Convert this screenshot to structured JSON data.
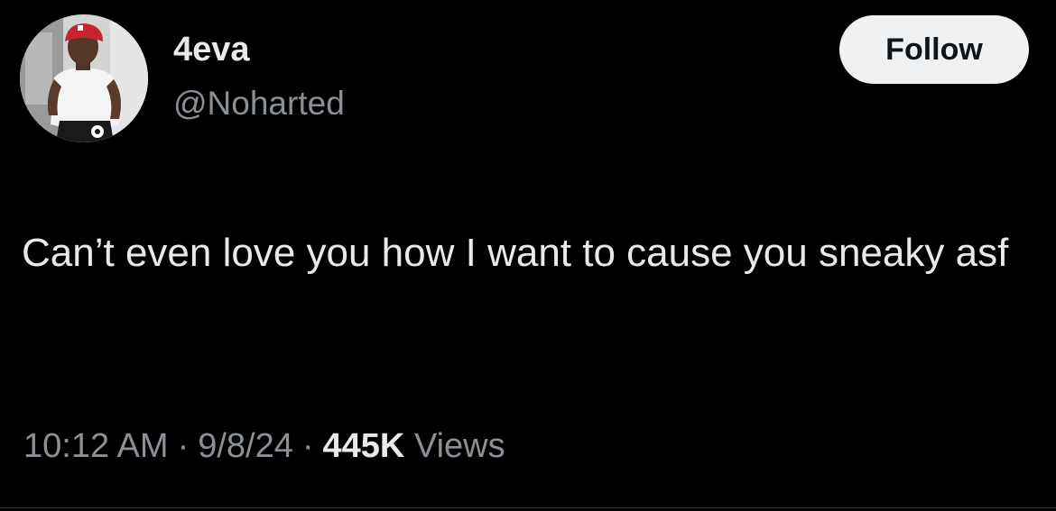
{
  "user": {
    "display_name": "4eva",
    "handle": "@Noharted"
  },
  "follow_button": {
    "label": "Follow"
  },
  "tweet": {
    "text": "Can’t even love you how I want to cause you sneaky asf"
  },
  "meta": {
    "time": "10:12 AM",
    "separator": "·",
    "date": "9/8/24",
    "views_count": "445K",
    "views_label": "Views"
  },
  "colors": {
    "background": "#000000",
    "primary_text": "#e7e9ea",
    "secondary_text": "#8b9096",
    "button_bg": "#eff1f2",
    "button_text": "#0f1419"
  }
}
